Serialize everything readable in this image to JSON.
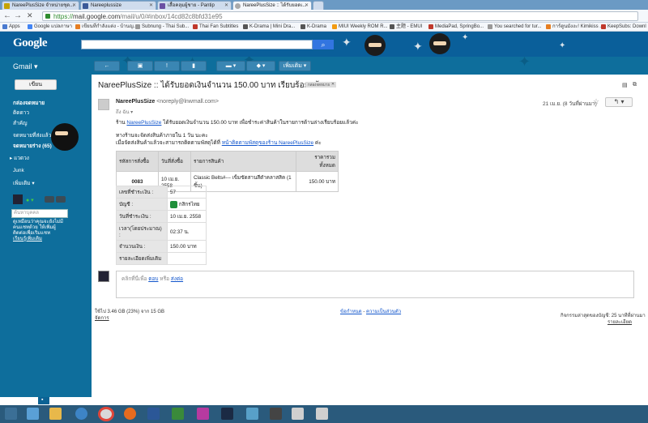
{
  "browser": {
    "tabs": [
      {
        "label": "NareePlusSize จำหน่ายชุด..."
      },
      {
        "label": "Nareeplussize"
      },
      {
        "label": "เสื้อคลุมผู้ชาย - Pantip"
      },
      {
        "label": "NareePlusSize :: ได้รับยอดเ...",
        "active": true
      }
    ],
    "url_prefix": "https://",
    "url_host": "mail.google.com",
    "url_path": "/mail/u/0/#inbox/14cd82c8bfd31e95",
    "bookmarks": [
      {
        "label": "Apps"
      },
      {
        "label": "Google แปลภาษา"
      },
      {
        "label": "เขียนที่กำลังแต่ง - บ้านญ..."
      },
      {
        "label": "Subnung - Thai Sub..."
      },
      {
        "label": "Thai Fan Subtitles"
      },
      {
        "label": "K-Drama | Mini Dra..."
      },
      {
        "label": "K-Drama"
      },
      {
        "label": "MIUI Weekly ROM R..."
      },
      {
        "label": "主题 - EMUI"
      },
      {
        "label": "MediaPad, SpringBo..."
      },
      {
        "label": "You searched for tur..."
      },
      {
        "label": "การ์ตูนมังงะ! Kimikiss ..."
      },
      {
        "label": "KeepSubs: Downl"
      }
    ]
  },
  "header": {
    "logo": "Google",
    "app_label": "Gmail ▾",
    "more_label": "เพิ่มเติม ▾"
  },
  "sidebar": {
    "compose": "เขียน",
    "items": [
      {
        "label": "กล่องจดหมาย",
        "bold": true
      },
      {
        "label": "ติดดาว"
      },
      {
        "label": "สำคัญ"
      },
      {
        "label": "จดหมายที่ส่งแล้ว"
      },
      {
        "label": "จดหมายร่าง (65)",
        "bold": true
      },
      {
        "label": "▸ แวดวง"
      },
      {
        "label": "Junk"
      },
      {
        "label": "เพิ่มเติม ▾"
      }
    ],
    "chat_search_placeholder": "ค้นหาบุคคล",
    "chat_note": [
      "ดูเหมือนว่าคุณจะยังไม่มี",
      "คนแชทด้วย ให้เพิ่มผู้",
      "ติดต่อเพื่อเริ่มแชท",
      "เรียนรู้เพิ่มเติม"
    ]
  },
  "email": {
    "subject": "NareePlusSize :: ได้รับยอดเงินจำนวน 150.00 บาท เรียบร้อยแล้ว",
    "label": "กล่องจดหมาย",
    "sender_name": "NareePlusSize",
    "sender_email": "<noreply@lnwmall.com>",
    "to": "ถึง ฉัน ▾",
    "date": "21 เม.ย. (8 วันที่ผ่านมา)",
    "line1_pre": "ร้าน",
    "line1_link": "NareePlusSize",
    "line1_post": "ได้รับยอดเงินจำนวน 150.00 บาท เพื่อชำระค่าสินค้าในรายการด้านล่างเรียบร้อยแล้วค่ะ",
    "line2": "ทางร้านจะจัดส่งสินค้าภายใน 1 วัน นะคะ",
    "line3_pre": "เมื่อจัดส่งสินค้าแล้วจะสามารถติดตามพัสดุได้ที่",
    "line3_link": "หน้าติดตามพัสดุของร้าน NareePlusSize",
    "line3_post": "ค่ะ",
    "order_table": {
      "headers": [
        "รหัสการสั่งซื้อ",
        "วันที่สั่งซื้อ",
        "รายการสินค้า",
        "ราคารวมทั้งหมด"
      ],
      "rows": [
        [
          "0083",
          "10 เม.ย. 2558",
          "Classic Belts#--- เข็มขัดสานสีดำคลาสสิค (1 ชิ้น)",
          "150.00 บาท"
        ]
      ]
    },
    "payment_table": [
      {
        "key": "เลขที่ชำระเงิน :",
        "value": "57"
      },
      {
        "key": "บัญชี :",
        "value": "กสิกรไทย"
      },
      {
        "key": "วันที่ชำระเงิน :",
        "value": "10 เม.ย. 2558"
      },
      {
        "key": "เวลา(โดยประมาณ) :",
        "value": "02:37 น."
      },
      {
        "key": "จำนวนเงิน :",
        "value": "150.00 บาท"
      },
      {
        "key": "รายละเอียดเพิ่มเติม",
        "value": ""
      }
    ],
    "reply_pre": "คลิกที่นี่เพื่อ",
    "reply_link1": "ตอบ",
    "reply_mid": "หรือ",
    "reply_link2": "ส่งต่อ"
  },
  "footer": {
    "storage": "ใช้ไป 3.46 GB (23%) จาก 15 GB",
    "manage": "จัดการ",
    "terms": "ข้อกำหนด",
    "privacy": "ความเป็นส่วนตัว",
    "activity": "กิจกรรมล่าสุดของบัญชี: 25 นาทีที่ผ่านมา",
    "details": "รายละเอียด"
  },
  "taskbar": {
    "time": "",
    "date": ""
  },
  "colors": {
    "header_bg": "#0a5f9a",
    "theme_bg": "#0e6e9c",
    "link": "#1155cc"
  }
}
